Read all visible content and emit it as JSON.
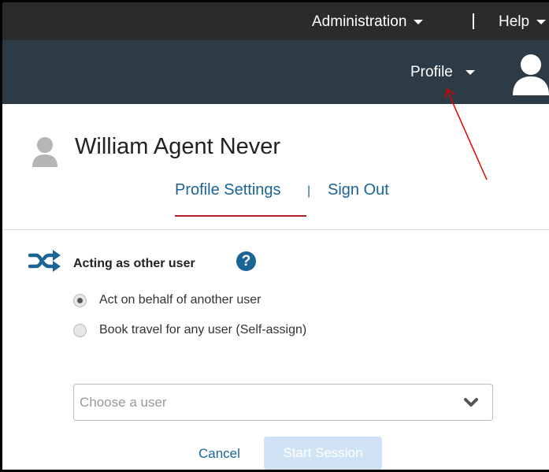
{
  "header": {
    "admin_label": "Administration",
    "help_label": "Help",
    "profile_label": "Profile"
  },
  "profile": {
    "user_name": "William Agent Never",
    "settings_link": "Profile Settings",
    "separator": "|",
    "signout_link": "Sign Out"
  },
  "acting": {
    "title": "Acting as other user",
    "help_symbol": "?",
    "options": [
      {
        "label": "Act on behalf of another user",
        "selected": true
      },
      {
        "label": "Book travel for any user (Self-assign)",
        "selected": false
      }
    ],
    "select_placeholder": "Choose a user",
    "cancel_label": "Cancel",
    "start_label": "Start Session"
  },
  "colors": {
    "header_bg": "#2d3b47",
    "link": "#1a6496",
    "active_underline": "#b32025",
    "annotation": "#e00000"
  },
  "icons": {
    "user": "person-icon",
    "shuffle": "shuffle-icon",
    "help": "question-circle-icon",
    "dropdown": "chevron-down-icon"
  }
}
